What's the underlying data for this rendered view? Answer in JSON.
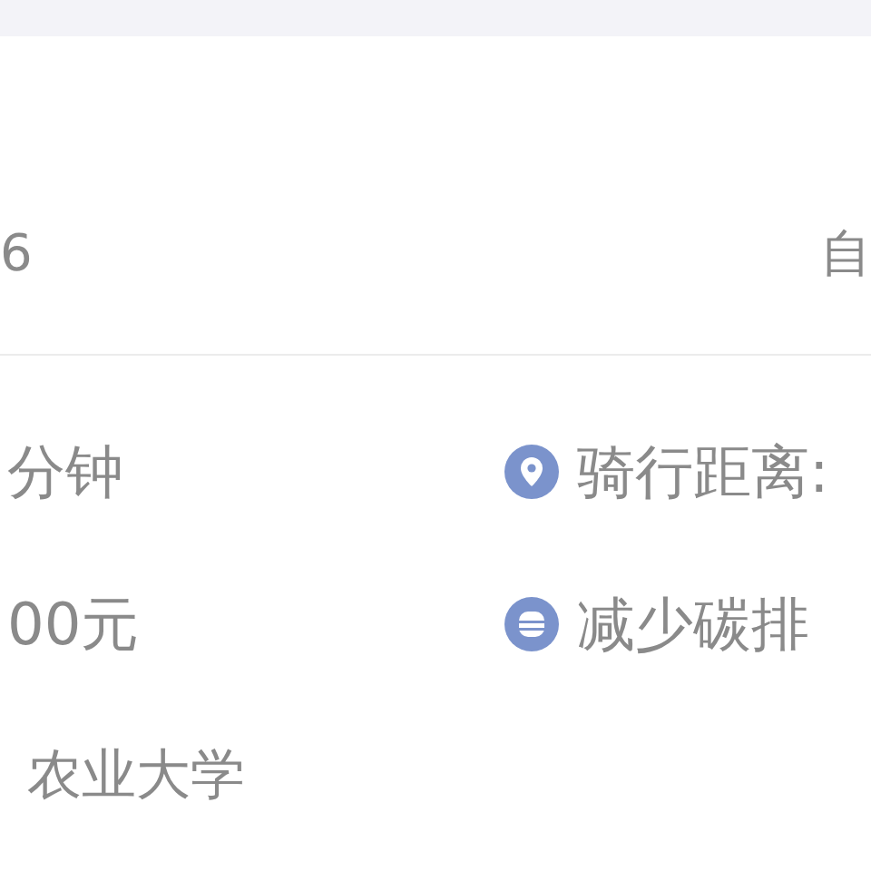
{
  "header": {
    "value": "6",
    "label": "自"
  },
  "stats": [
    {
      "left": "分钟",
      "right": {
        "kind": "distance",
        "text": "骑行距离:"
      }
    },
    {
      "left": "00元",
      "right": {
        "kind": "carbon",
        "text": "减少碳排"
      }
    }
  ],
  "location": "农业大学"
}
